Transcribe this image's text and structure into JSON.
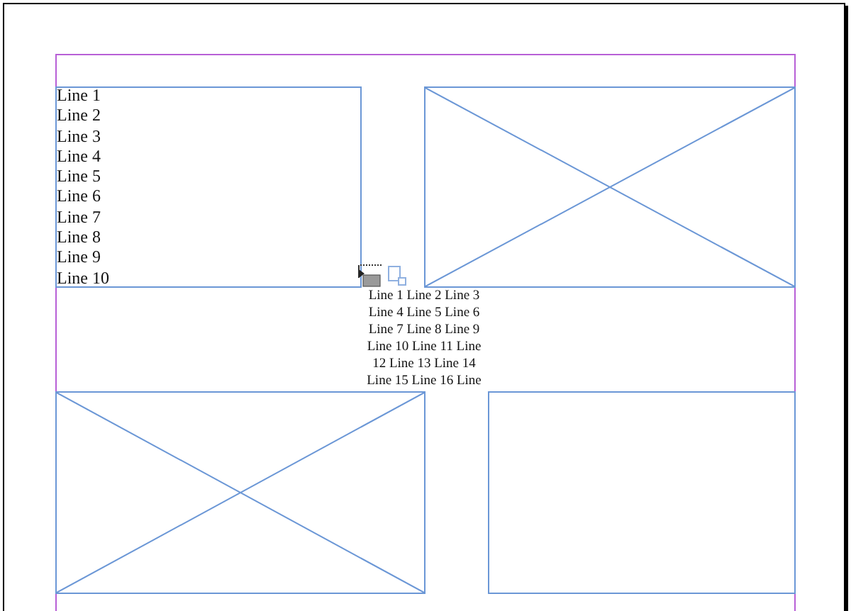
{
  "frames": [
    {
      "kind": "text",
      "lines": [
        "Line 1",
        "Line 2",
        "Line 3",
        "Line 4",
        "Line 5",
        "Line 6",
        "Line 7",
        "Line 8",
        "Line 9",
        "Line 10"
      ]
    },
    {
      "kind": "image"
    },
    {
      "kind": "image"
    },
    {
      "kind": "empty"
    }
  ],
  "overset_text": {
    "lines": [
      "Line 1 Line 2 Line 3",
      "Line 4 Line 5 Line 6",
      "Line 7 Line 8 Line 9",
      "Line 10 Line 11 Line",
      "12 Line 13 Line 14",
      "Line 15 Line 16 Line"
    ]
  }
}
